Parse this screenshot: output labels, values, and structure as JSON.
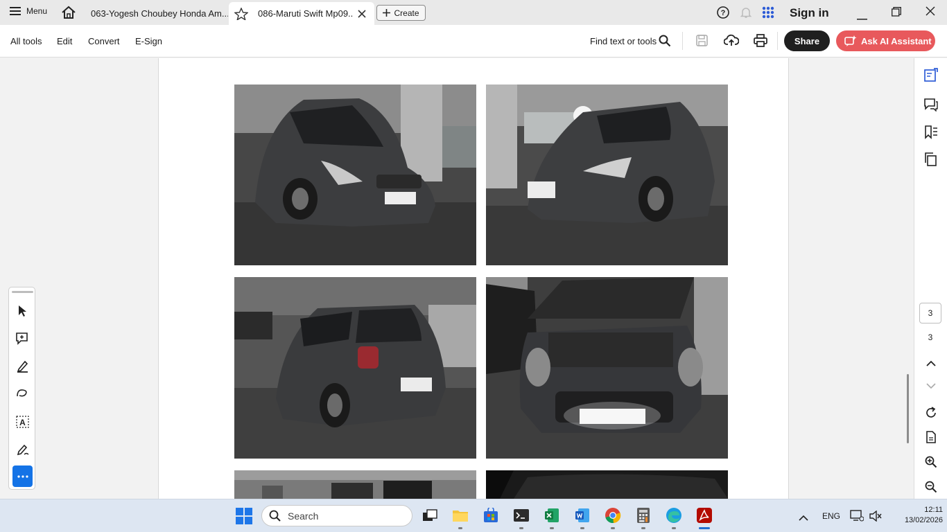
{
  "tabbar": {
    "menu_label": "Menu",
    "tabs": [
      {
        "label": "063-Yogesh Choubey Honda Am..."
      },
      {
        "label": "086-Maruti Swift Mp09..."
      }
    ],
    "create_label": "Create",
    "signin_label": "Sign in"
  },
  "toolbar": {
    "menus": [
      "All tools",
      "Edit",
      "Convert",
      "E-Sign"
    ],
    "find_label": "Find text or tools",
    "share_label": "Share",
    "ai_label": "Ask AI Assistant"
  },
  "document": {
    "photos": [
      {
        "subject": "car-front-left"
      },
      {
        "subject": "car-front-right"
      },
      {
        "subject": "car-rear-left"
      },
      {
        "subject": "car-front-hood-open"
      },
      {
        "subject": "car-parking-lot"
      },
      {
        "subject": "car-interior-dark"
      }
    ]
  },
  "right_rail": {
    "current_page": "3",
    "total_pages": "3"
  },
  "taskbar": {
    "search_placeholder": "Search",
    "language": "ENG",
    "time": "12:11",
    "date": "13/02/2026"
  },
  "colors": {
    "accent": "#1473e6",
    "ai_button": "#e8595c",
    "share_button": "#1f1f1f",
    "taskbar": "#dde6f2"
  }
}
